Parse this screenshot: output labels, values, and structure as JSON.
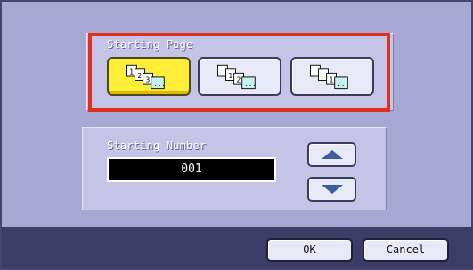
{
  "starting_page": {
    "title": "Starting Page",
    "options": [
      {
        "id": "page-1",
        "selected": true,
        "icon": "pages-1-2-3-icon",
        "digits": [
          "1",
          "2",
          "3"
        ]
      },
      {
        "id": "page-2",
        "selected": false,
        "icon": "pages-blank-1-2-icon",
        "digits": [
          "1",
          "2"
        ]
      },
      {
        "id": "page-3",
        "selected": false,
        "icon": "pages-blank-blank-1-icon",
        "digits": [
          "1"
        ]
      }
    ]
  },
  "starting_number": {
    "title": "Starting Number",
    "value": "001"
  },
  "footer": {
    "ok_label": "OK",
    "cancel_label": "Cancel"
  },
  "colors": {
    "background": "#a7a8d4",
    "panel": "#c4c5e6",
    "footer": "#3b3d66",
    "selected_button": "#ffee38",
    "highlight_border": "#e0301e",
    "arrow": "#3a5f9c"
  }
}
